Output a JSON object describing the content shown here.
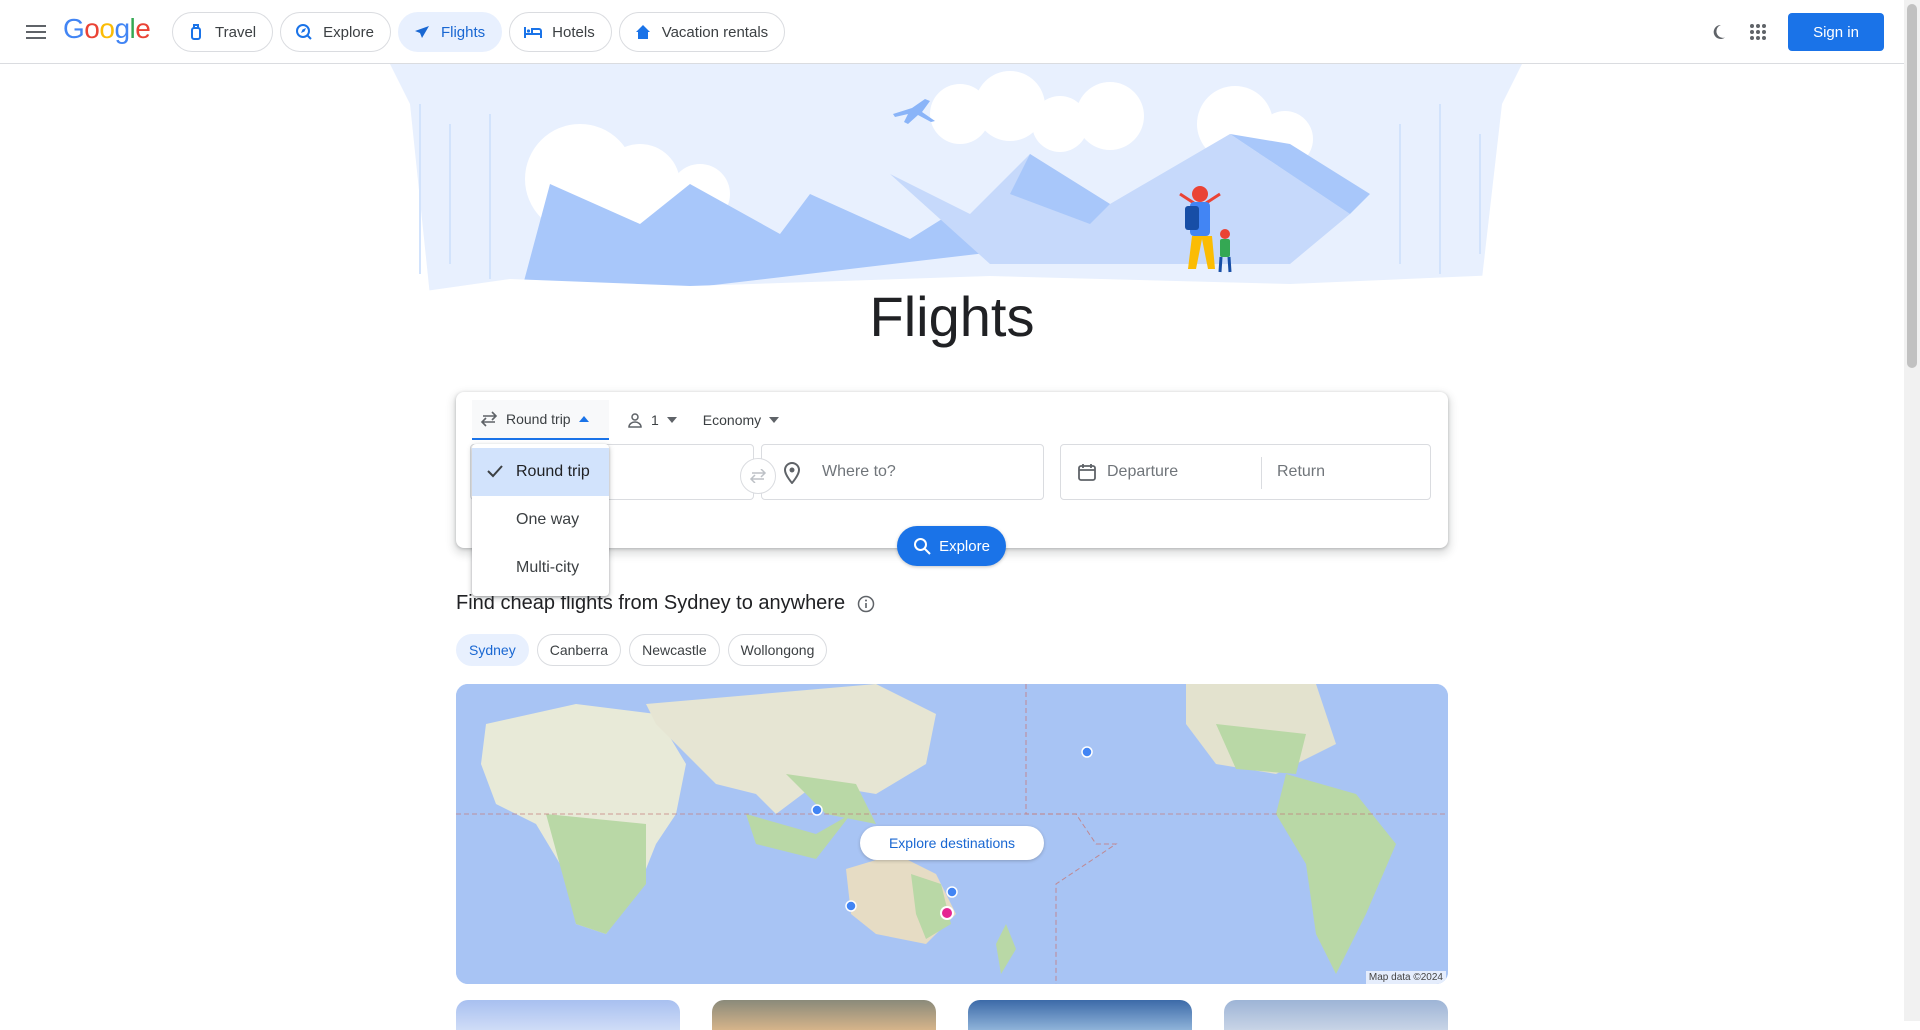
{
  "header": {
    "brand": "Google",
    "nav": [
      {
        "label": "Travel",
        "icon": "luggage-icon",
        "active": false
      },
      {
        "label": "Explore",
        "icon": "explore-icon",
        "active": false
      },
      {
        "label": "Flights",
        "icon": "plane-icon",
        "active": true
      },
      {
        "label": "Hotels",
        "icon": "bed-icon",
        "active": false
      },
      {
        "label": "Vacation rentals",
        "icon": "house-icon",
        "active": false
      }
    ],
    "sign_in": "Sign in"
  },
  "page": {
    "title": "Flights"
  },
  "search": {
    "trip_type": "Round trip",
    "passengers": "1",
    "cabin": "Economy",
    "to_placeholder": "Where to?",
    "departure_placeholder": "Departure",
    "return_placeholder": "Return",
    "explore_label": "Explore"
  },
  "trip_menu": {
    "items": [
      {
        "label": "Round trip",
        "selected": true
      },
      {
        "label": "One way",
        "selected": false
      },
      {
        "label": "Multi-city",
        "selected": false
      }
    ]
  },
  "cheap_flights": {
    "title": "Find cheap flights from Sydney to anywhere",
    "cities": [
      {
        "label": "Sydney",
        "active": true
      },
      {
        "label": "Canberra",
        "active": false
      },
      {
        "label": "Newcastle",
        "active": false
      },
      {
        "label": "Wollongong",
        "active": false
      }
    ],
    "map_button": "Explore destinations",
    "map_credit": "Map data ©2024"
  },
  "colors": {
    "accent": "#1a73e8",
    "accent_text": "#1967d2",
    "chip_active_bg": "#e8f0fe",
    "menu_selected_bg": "#d2e3fc"
  }
}
